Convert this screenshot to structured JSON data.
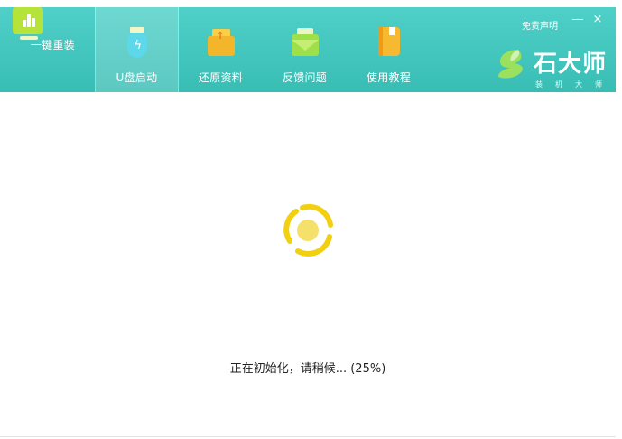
{
  "nav": {
    "items": [
      {
        "label": "一键重装",
        "icon": "bar-chart-icon"
      },
      {
        "label": "U盘启动",
        "icon": "usb-drive-icon",
        "active": true
      },
      {
        "label": "还原资料",
        "icon": "restore-box-icon"
      },
      {
        "label": "反馈问题",
        "icon": "feedback-envelope-icon"
      },
      {
        "label": "使用教程",
        "icon": "tutorial-book-icon"
      }
    ]
  },
  "window_controls": {
    "disclaimer": "免责声明",
    "minimize": "—",
    "close": "×"
  },
  "brand": {
    "name": "石大师",
    "subtitle": "装机大师"
  },
  "progress": {
    "status_text": "正在初始化，请稍候...  (25%)",
    "percent": 25
  },
  "colors": {
    "header": "#3ec4bb",
    "spinner": "#f2d010",
    "spinner_center": "#f5e06a"
  }
}
